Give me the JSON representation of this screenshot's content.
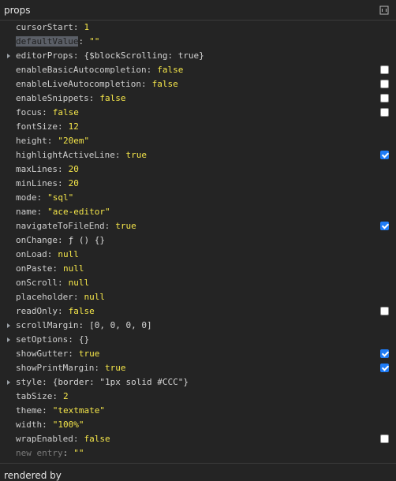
{
  "header": {
    "title": "props",
    "settings_icon": "view-source-icon"
  },
  "rows": [
    {
      "key": "cursorStart",
      "value": "1",
      "type": "number"
    },
    {
      "key": "defaultValue",
      "value": "\"\"",
      "type": "string",
      "selected": true
    },
    {
      "key": "editorProps",
      "value": "{$blockScrolling: true}",
      "type": "object",
      "expandable": true
    },
    {
      "key": "enableBasicAutocompletion",
      "value": "false",
      "type": "bool",
      "checkbox": false
    },
    {
      "key": "enableLiveAutocompletion",
      "value": "false",
      "type": "bool",
      "checkbox": false
    },
    {
      "key": "enableSnippets",
      "value": "false",
      "type": "bool",
      "checkbox": false
    },
    {
      "key": "focus",
      "value": "false",
      "type": "bool",
      "checkbox": false
    },
    {
      "key": "fontSize",
      "value": "12",
      "type": "number"
    },
    {
      "key": "height",
      "value": "\"20em\"",
      "type": "string"
    },
    {
      "key": "highlightActiveLine",
      "value": "true",
      "type": "bool",
      "checkbox": true
    },
    {
      "key": "maxLines",
      "value": "20",
      "type": "number"
    },
    {
      "key": "minLines",
      "value": "20",
      "type": "number"
    },
    {
      "key": "mode",
      "value": "\"sql\"",
      "type": "string"
    },
    {
      "key": "name",
      "value": "\"ace-editor\"",
      "type": "string"
    },
    {
      "key": "navigateToFileEnd",
      "value": "true",
      "type": "bool",
      "checkbox": true
    },
    {
      "key": "onChange",
      "value": "ƒ () {}",
      "type": "func"
    },
    {
      "key": "onLoad",
      "value": "null",
      "type": "null"
    },
    {
      "key": "onPaste",
      "value": "null",
      "type": "null"
    },
    {
      "key": "onScroll",
      "value": "null",
      "type": "null"
    },
    {
      "key": "placeholder",
      "value": "null",
      "type": "null"
    },
    {
      "key": "readOnly",
      "value": "false",
      "type": "bool",
      "checkbox": false
    },
    {
      "key": "scrollMargin",
      "value": "[0, 0, 0, 0]",
      "type": "object",
      "expandable": true
    },
    {
      "key": "setOptions",
      "value": "{}",
      "type": "object",
      "expandable": true
    },
    {
      "key": "showGutter",
      "value": "true",
      "type": "bool",
      "checkbox": true
    },
    {
      "key": "showPrintMargin",
      "value": "true",
      "type": "bool",
      "checkbox": true
    },
    {
      "key": "style",
      "value": "{border: \"1px solid #CCC\"}",
      "type": "object",
      "expandable": true
    },
    {
      "key": "tabSize",
      "value": "2",
      "type": "number"
    },
    {
      "key": "theme",
      "value": "\"textmate\"",
      "type": "string"
    },
    {
      "key": "width",
      "value": "\"100%\"",
      "type": "string"
    },
    {
      "key": "wrapEnabled",
      "value": "false",
      "type": "bool",
      "checkbox": false
    },
    {
      "key": "new entry",
      "value": "\"\"",
      "type": "string",
      "placeholder": true
    }
  ],
  "footer": {
    "label": "rendered by"
  },
  "colors": {
    "background": "#242424",
    "value": "#f5e64a",
    "checkbox_checked": "#1f7cf6"
  }
}
